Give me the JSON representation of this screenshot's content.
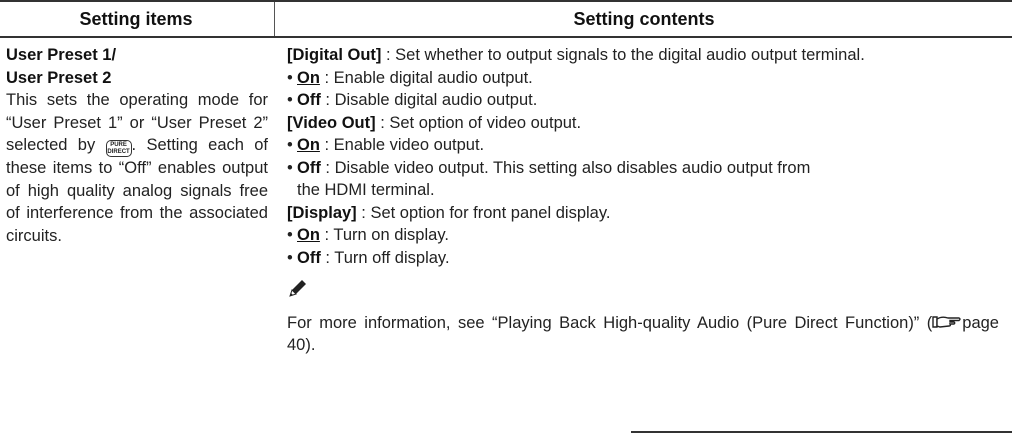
{
  "header": {
    "col1": "Setting items",
    "col2": "Setting contents"
  },
  "left": {
    "title_line1": "User Preset 1/",
    "title_line2": "User Preset 2",
    "desc_part1": "This sets the operating mode for “User Preset 1” or “User Preset 2” selected by",
    "desc_icon_line1": "PURE",
    "desc_icon_line2": "DIRECT",
    "desc_part2": ".",
    "desc_part3": "Setting each of these items to “Off” enables output of high quality analog signals free of interference from the associated circuits."
  },
  "right": {
    "digital_out_label": "[Digital Out]",
    "digital_out_text": " : Set whether to output signals to the digital audio output terminal.",
    "digital_on_label": "On",
    "digital_on_text": " : Enable digital audio output.",
    "digital_off_label": "Off",
    "digital_off_text": " : Disable digital audio output.",
    "video_out_label": "[Video Out]",
    "video_out_text": " : Set option of video output.",
    "video_on_label": "On",
    "video_on_text": " : Enable video output.",
    "video_off_label": "Off",
    "video_off_text": " : Disable video output. This setting also disables audio output from",
    "video_off_text2": "the HDMI terminal.",
    "display_label": "[Display]",
    "display_text": " : Set option for front panel display.",
    "display_on_label": "On",
    "display_on_text": " : Turn on display.",
    "display_off_label": "Off",
    "display_off_text": " : Turn off display.",
    "note_icon": "pencil-icon",
    "note_text_part1": "For more information, see “Playing Back High-quality Audio (Pure Direct Function)” (",
    "note_ref_icon": "reference-hand-icon",
    "note_text_part2": "page 40)."
  }
}
